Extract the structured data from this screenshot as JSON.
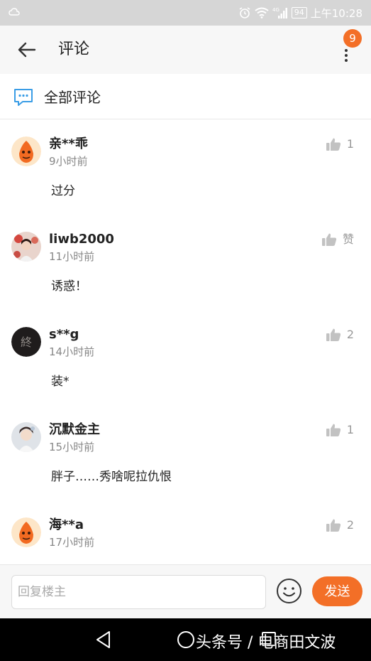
{
  "status_bar": {
    "network": "4G",
    "battery": "94",
    "time": "上午10:28"
  },
  "header": {
    "title": "评论",
    "badge_count": "9",
    "back_icon": "arrow-left-icon",
    "more_icon": "more-vertical-icon"
  },
  "section": {
    "title": "全部评论",
    "icon": "comment-bubble-icon"
  },
  "comments": [
    {
      "name": "亲**乖",
      "time": "9小时前",
      "text": "过分",
      "likes": "1",
      "avatar": "orange-cartoon-avatar"
    },
    {
      "name": "liwb2000",
      "time": "11小时前",
      "text": "诱惑！",
      "likes": "赞",
      "avatar": "photo-avatar"
    },
    {
      "name": "s**g",
      "time": "14小时前",
      "text": "装*",
      "likes": "2",
      "avatar": "dark-seal-avatar"
    },
    {
      "name": "沉默金主",
      "time": "15小时前",
      "text": "胖子……秀啥呢拉仇恨",
      "likes": "1",
      "avatar": "photo-avatar"
    },
    {
      "name": "海**a",
      "time": "17小时前",
      "text": "",
      "likes": "2",
      "avatar": "orange-cartoon-avatar"
    }
  ],
  "reply_bar": {
    "placeholder": "回复楼主",
    "send_label": "发送",
    "emoji_icon": "smiley-icon"
  },
  "nav": {
    "watermark": "头条号 / 电商田文波"
  },
  "colors": {
    "accent": "#f36f27",
    "status_bar": "#d6d6d6",
    "header_bg": "#f7f7f7",
    "icon_gray": "#c2c2c2"
  }
}
